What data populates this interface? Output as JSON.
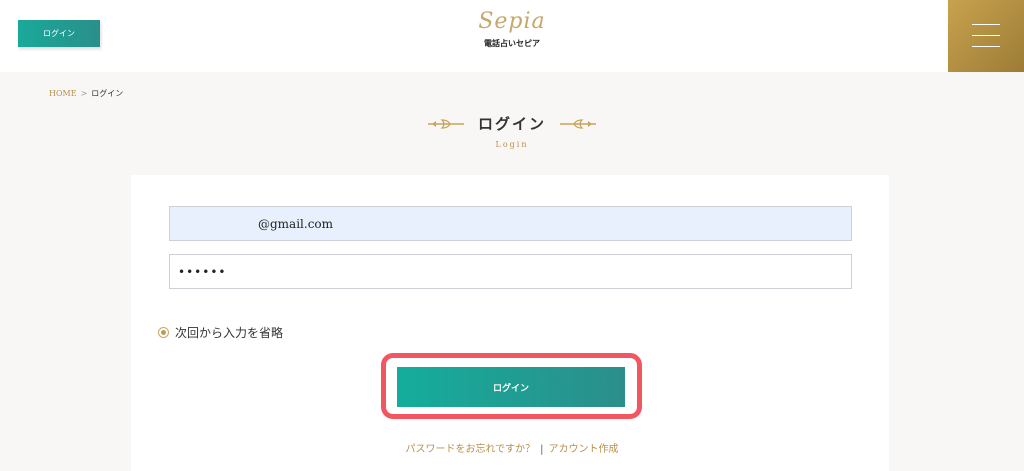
{
  "header": {
    "login_button": "ログイン",
    "logo_script": "Sepia",
    "logo_subtitle": "電話占いセピア",
    "menu_icon": "hamburger-menu-icon"
  },
  "breadcrumb": {
    "home": "HOME",
    "separator": ">",
    "current": "ログイン"
  },
  "page": {
    "title": "ログイン",
    "subtitle": "Login"
  },
  "form": {
    "email_value": "@gmail.com",
    "password_value": "••••••",
    "remember_label": "次回から入力を省略",
    "remember_checked": true,
    "submit_label": "ログイン"
  },
  "links": {
    "forgot_password": "パスワードをお忘れですか？",
    "divider": "|",
    "create_account": "アカウント作成"
  },
  "colors": {
    "teal": "#19a99a",
    "gold": "#b8904a",
    "highlight": "#f25661"
  }
}
